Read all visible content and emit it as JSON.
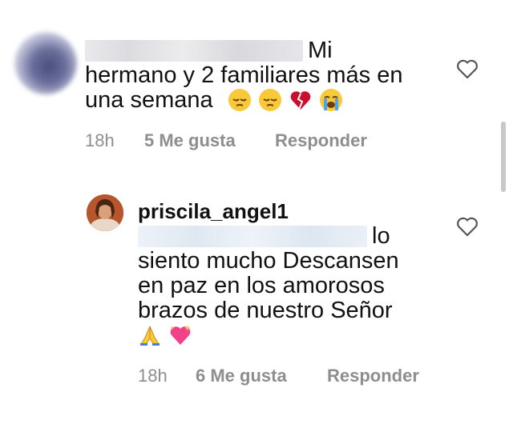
{
  "comments": [
    {
      "text_line1": "Mi",
      "text_line2": "hermano y 2 familiares más en",
      "text_line3": "una semana",
      "emojis": [
        "pensive-face",
        "pensive-face",
        "broken-heart",
        "loudly-crying-face"
      ],
      "time": "18h",
      "likes": "5 Me gusta",
      "reply": "Responder"
    },
    {
      "username": "priscila_angel1",
      "text_line1": "lo",
      "text_line2": "siento mucho Descansen",
      "text_line3": "en paz en los amorosos",
      "text_line4": "brazos de nuestro Señor",
      "emojis": [
        "folded-hands",
        "sparkling-heart"
      ],
      "time": "18h",
      "likes": "6 Me gusta",
      "reply": "Responder"
    }
  ],
  "colors": {
    "meta_text": "#8e8e8e",
    "text": "#111111",
    "heart_stroke": "#555555"
  }
}
